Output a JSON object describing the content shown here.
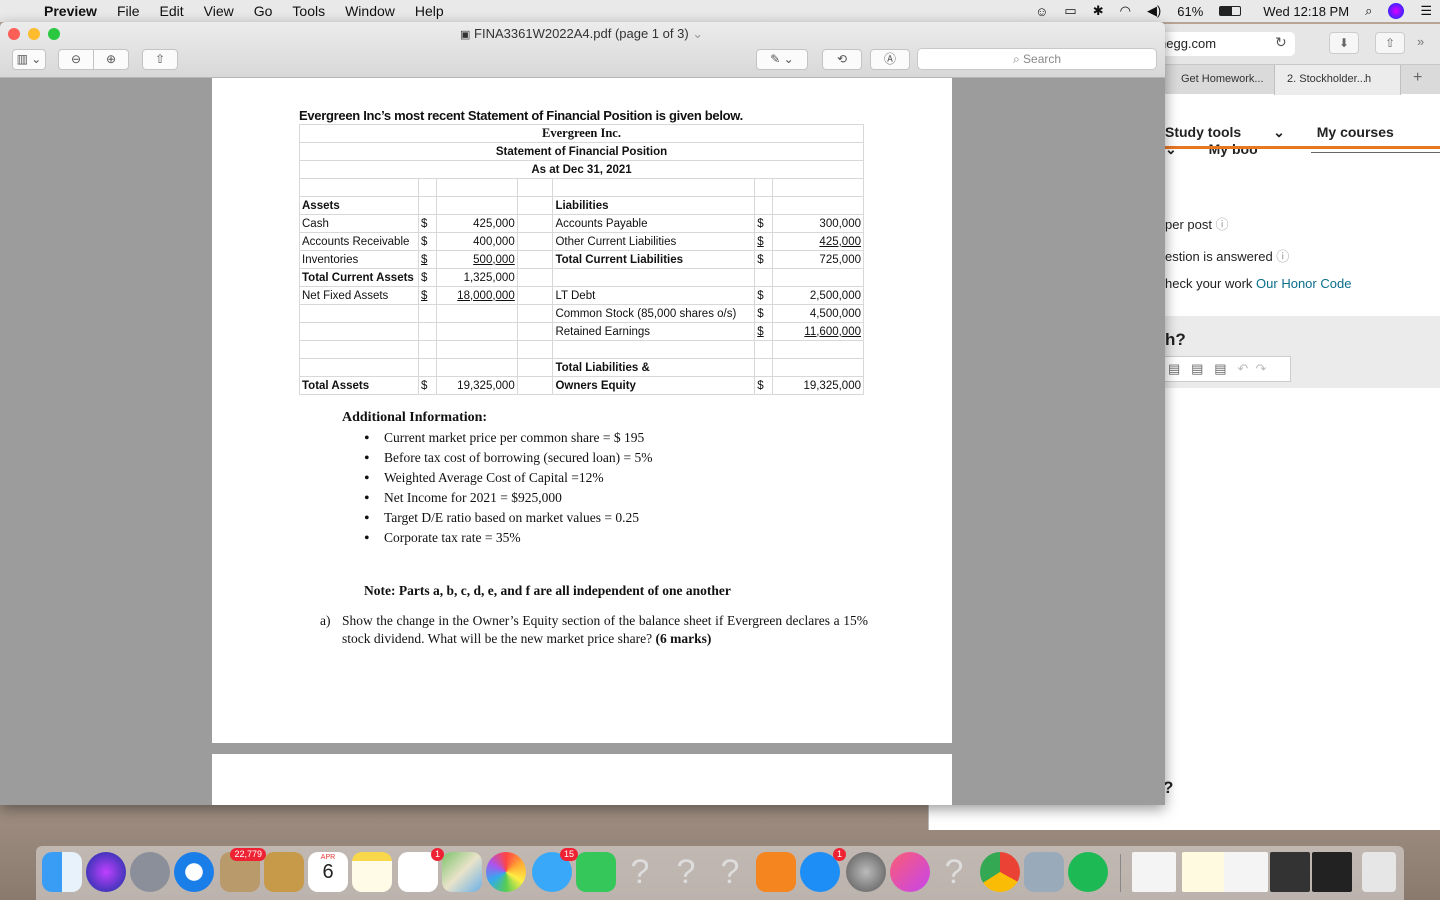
{
  "menubar": {
    "app": "Preview",
    "items": [
      "File",
      "Edit",
      "View",
      "Go",
      "Tools",
      "Window",
      "Help"
    ],
    "battery": "61%",
    "clock": "Wed 12:18 PM"
  },
  "window": {
    "title": "FINA3361W2022A4.pdf (page 1 of 3)",
    "search_placeholder": "Search"
  },
  "document": {
    "intro": "Evergreen Inc’s most recent Statement of Financial Position is given below.",
    "company": "Evergreen Inc.",
    "statement": "Statement of Financial Position",
    "date": "As at Dec 31, 2021",
    "rows": [
      {
        "l": "Assets",
        "ls": "",
        "lv": "",
        "r": "Liabilities",
        "rs": "",
        "rv": "",
        "lb": true,
        "rb": true
      },
      {
        "l": "Cash",
        "ls": "$",
        "lv": "425,000",
        "r": "Accounts Payable",
        "rs": "$",
        "rv": "300,000"
      },
      {
        "l": "Accounts Receivable",
        "ls": "$",
        "lv": "400,000",
        "r": "Other Current Liabilities",
        "rs": "$",
        "rv": "425,000",
        "rul": true
      },
      {
        "l": "Inventories",
        "ls": "$",
        "lv": "500,000",
        "lul": true,
        "r": "Total Current Liabilities",
        "rs": "$",
        "rv": "725,000",
        "rb": true
      },
      {
        "l": "Total Current Assets",
        "ls": "$",
        "lv": "1,325,000",
        "lb": true,
        "r": "",
        "rs": "",
        "rv": ""
      },
      {
        "l": "Net Fixed Assets",
        "ls": "$",
        "lv": "18,000,000",
        "lul": true,
        "r": "LT Debt",
        "rs": "$",
        "rv": "2,500,000"
      },
      {
        "l": "",
        "ls": "",
        "lv": "",
        "r": "Common Stock (85,000 shares o/s)",
        "rs": "$",
        "rv": "4,500,000"
      },
      {
        "l": "",
        "ls": "",
        "lv": "",
        "r": "Retained Earnings",
        "rs": "$",
        "rv": "11,600,000",
        "rul": true
      },
      {
        "l": "",
        "ls": "",
        "lv": "",
        "r": "",
        "rs": "",
        "rv": ""
      },
      {
        "l": "",
        "ls": "",
        "lv": "",
        "r": "Total Liabilities &",
        "rs": "",
        "rv": "",
        "rb": true
      },
      {
        "l": "Total Assets",
        "ls": "$",
        "lv": "19,325,000",
        "lb": true,
        "r": "Owners Equity",
        "rs": "$",
        "rv": "19,325,000",
        "rb": true
      }
    ],
    "additional_title": "Additional Information:",
    "additional": [
      "Current market price per common share = $ 195",
      "Before tax cost of borrowing (secured loan) = 5%",
      "Weighted Average Cost of Capital =12%",
      "Net Income for 2021 = $925,000",
      "Target D/E ratio based on market values = 0.25",
      "Corporate tax rate = 35%"
    ],
    "note": "Note: Parts a, b, c, d, e, and f are all independent of one another",
    "question_label": "a)",
    "question_text": "Show the change in the Owner’s Equity section of the balance sheet if Evergreen declares a 15% stock dividend. What will be the new market price share?",
    "question_marks": "(6 marks)"
  },
  "browser": {
    "url": "hegg.com",
    "tabs": [
      "Get Homework...",
      "2. Stockholder...",
      "h"
    ],
    "nav": [
      "Study tools",
      "My courses",
      "My boo"
    ],
    "lines": [
      "per post",
      "estion is answered",
      "heck your work"
    ],
    "honor_link": "Our Honor Code",
    "q_mark": "h?",
    "q_mark2": "?"
  },
  "dock": {
    "badge_contacts": "22,779",
    "calendar_month": "APR",
    "calendar_day": "6",
    "badge_reminders": "1",
    "badge_messages": "15",
    "badge_appstore": "1"
  }
}
